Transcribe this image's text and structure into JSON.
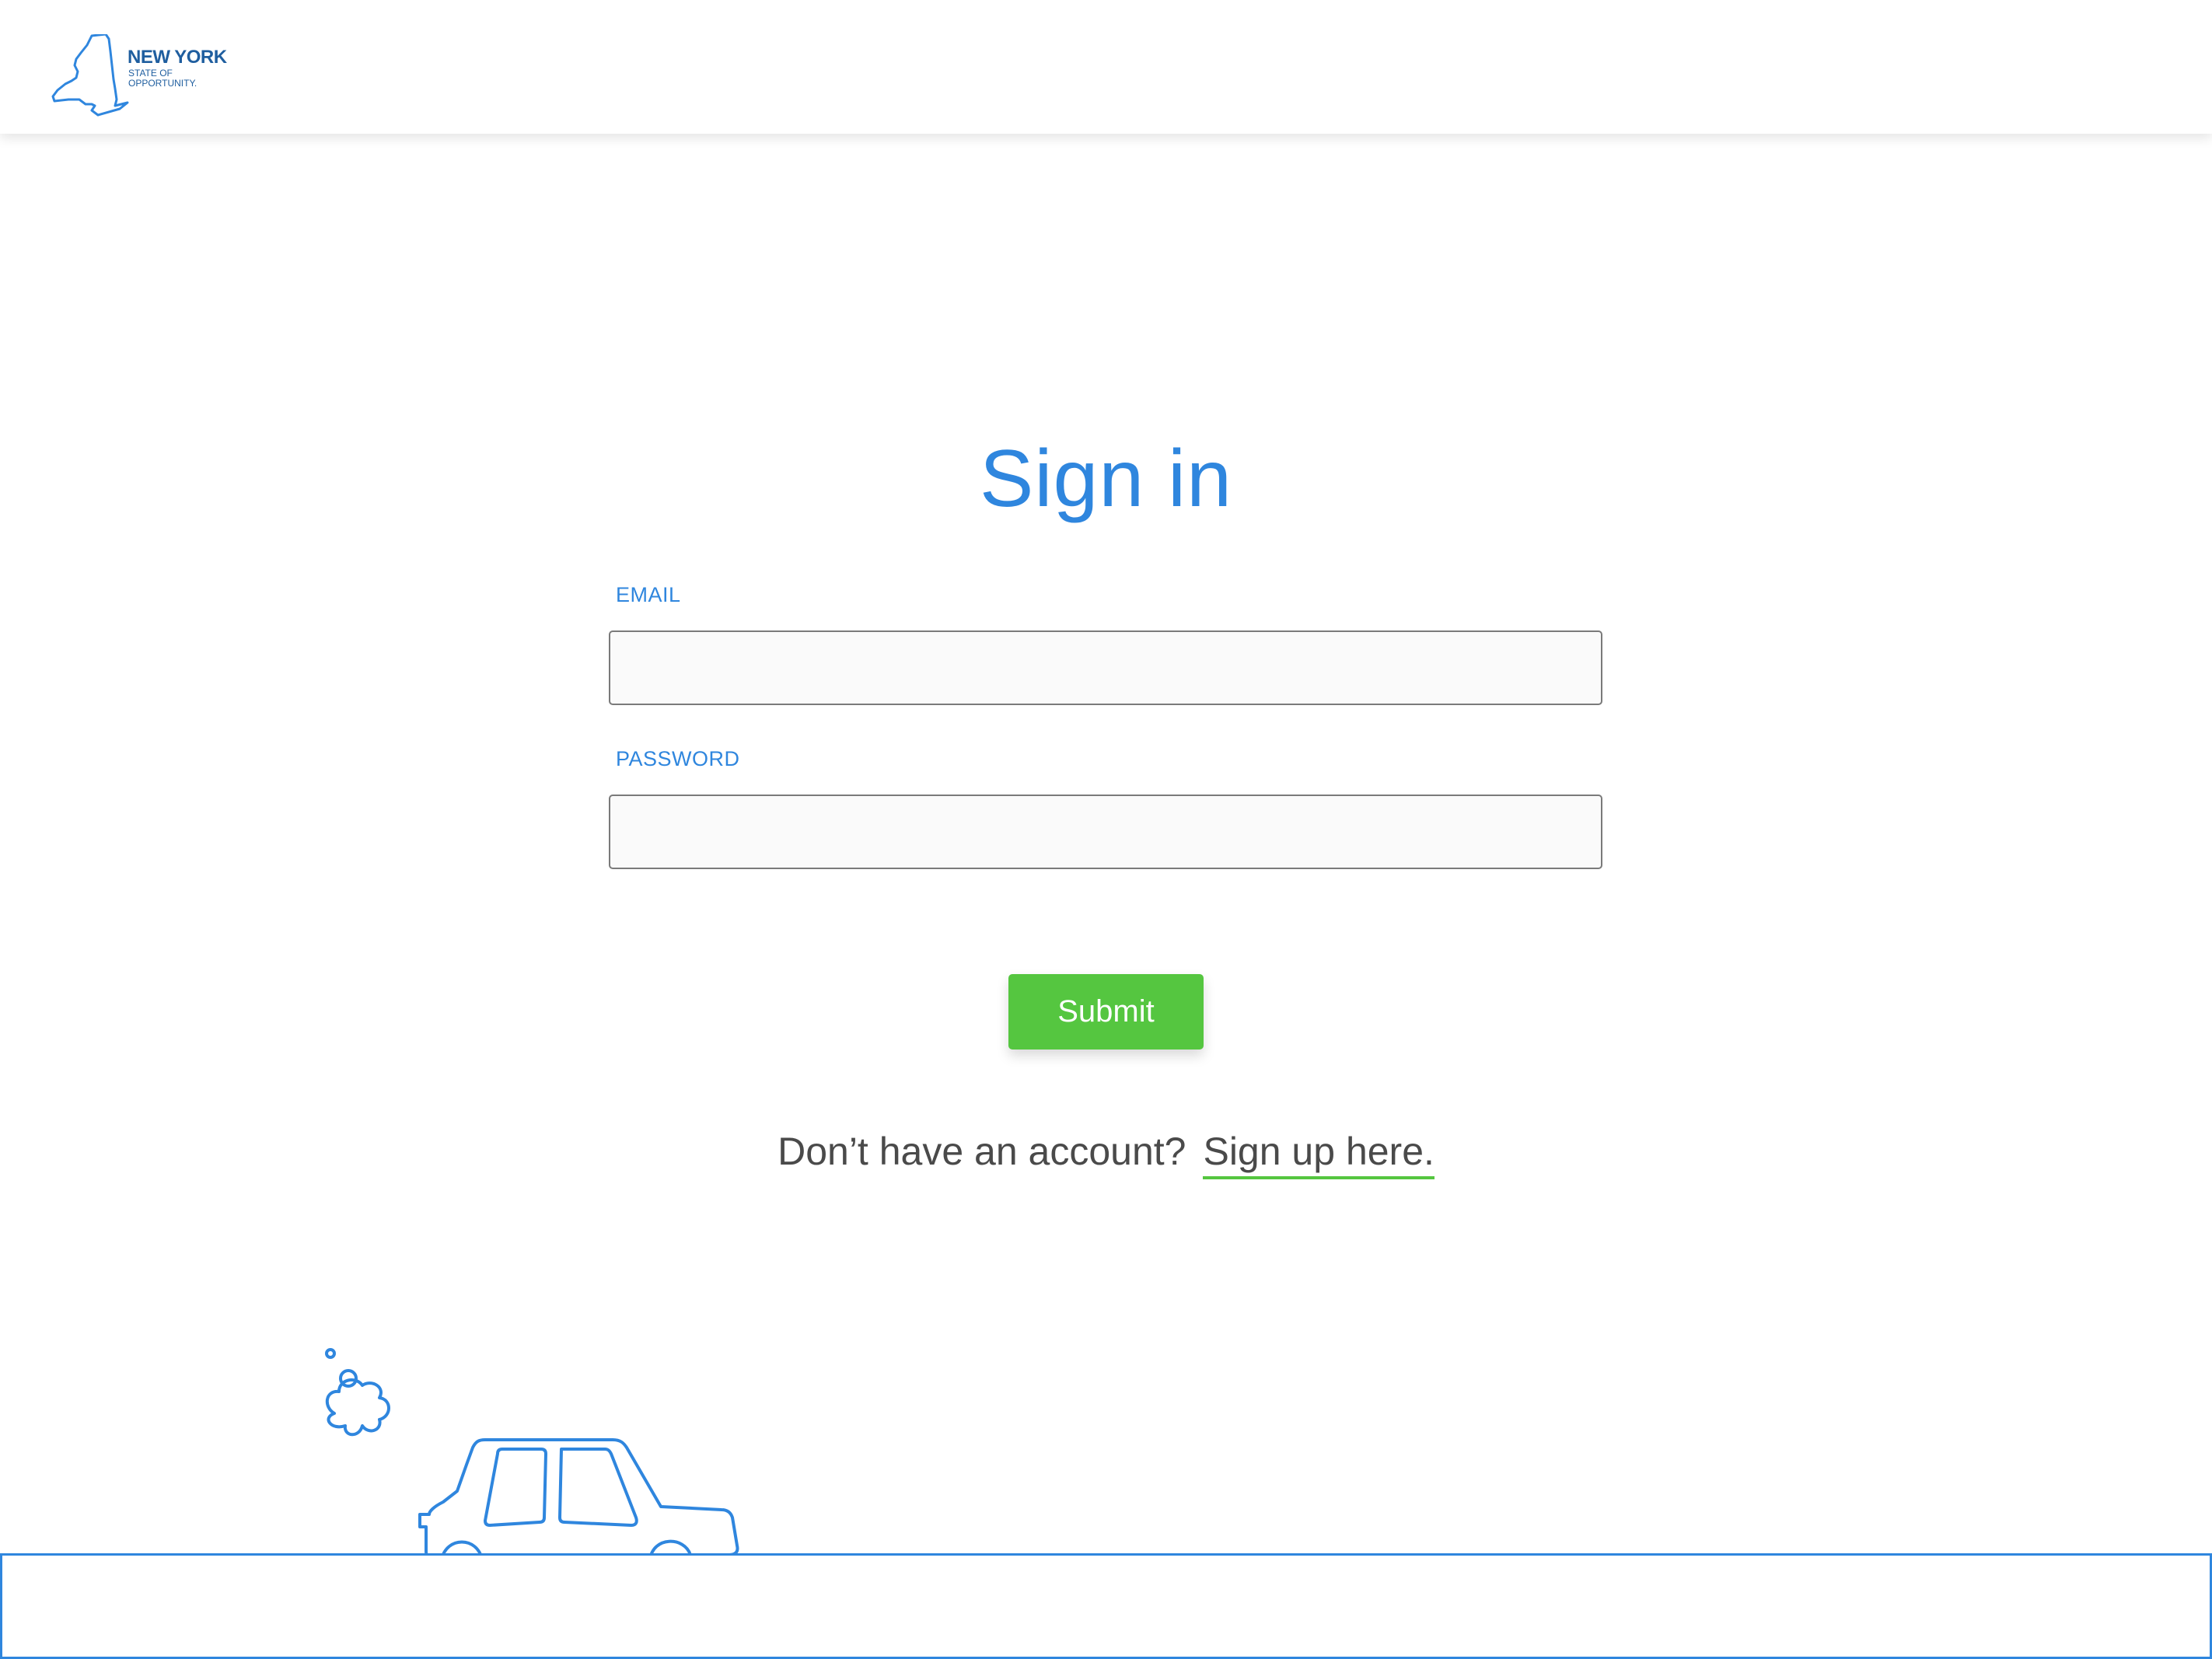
{
  "header": {
    "logo": {
      "icon": "new-york-state-outline-icon",
      "title": "NEW YORK",
      "subtitle_line1": "STATE OF",
      "subtitle_line2": "OPPORTUNITY."
    }
  },
  "main": {
    "title": "Sign in",
    "email_label": "EMAIL",
    "email_value": "",
    "password_label": "PASSWORD",
    "password_value": "",
    "submit_label": "Submit",
    "signup_prompt": "Don’t have an account?",
    "signup_link": "Sign up here."
  },
  "illustration": {
    "icon": "car-with-exhaust-icon"
  },
  "colors": {
    "primary_blue": "#2f86de",
    "logo_blue": "#1f5e9f",
    "submit_green": "#55c640",
    "text_gray": "#4a4a4a"
  }
}
